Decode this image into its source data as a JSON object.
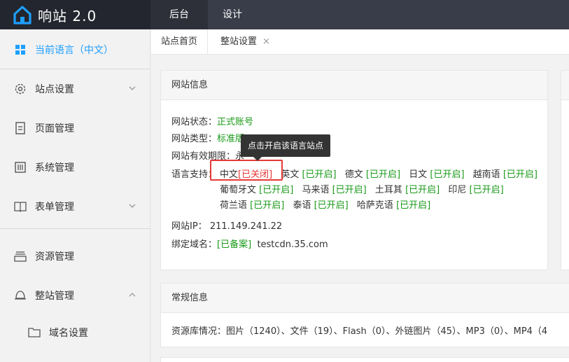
{
  "app": {
    "name": "响站 2.0"
  },
  "top_tabs": [
    {
      "label": "后台"
    },
    {
      "label": "设计"
    }
  ],
  "sidebar": {
    "items": [
      {
        "label": "当前语言（中文）",
        "icon": "grid-icon"
      },
      {
        "label": "站点设置",
        "icon": "gear-icon"
      },
      {
        "label": "页面管理",
        "icon": "document-icon"
      },
      {
        "label": "系统管理",
        "icon": "sliders-icon"
      },
      {
        "label": "表单管理",
        "icon": "book-icon"
      },
      {
        "label": "资源管理",
        "icon": "stack-icon"
      },
      {
        "label": "整站管理",
        "icon": "bell-icon"
      },
      {
        "label": "域名设置",
        "icon": "folder-icon"
      }
    ]
  },
  "page_tabs": [
    {
      "label": "站点首页"
    },
    {
      "label": "整站设置",
      "close": "×"
    }
  ],
  "site_info": {
    "title": "网站信息",
    "status_label": "网站状态：",
    "status_value": "正式账号",
    "type_label": "网站类型：",
    "type_value": "标准版",
    "expire_label": "网站有效期限：",
    "expire_value": "永",
    "lang_label": "语言支持：",
    "languages": [
      {
        "name": "中文",
        "state": "[已关闭]"
      },
      {
        "name": "英文",
        "state": "[已开启]"
      },
      {
        "name": "德文",
        "state": "[已开启]"
      },
      {
        "name": "日文",
        "state": "[已开启]"
      },
      {
        "name": "越南语",
        "state": "[已开启]"
      },
      {
        "name": "葡萄牙文",
        "state": "[已开启]"
      },
      {
        "name": "马来语",
        "state": "[已开启]"
      },
      {
        "name": "土耳其",
        "state": "[已开启]"
      },
      {
        "name": "印尼",
        "state": "[已开启]"
      },
      {
        "name": "荷兰语",
        "state": "[已开启]"
      },
      {
        "name": "泰语",
        "state": "[已开启]"
      },
      {
        "name": "哈萨克语",
        "state": "[已开启]"
      }
    ],
    "ip_label": "网站IP：",
    "ip_value": "211.149.241.22",
    "domain_label": "绑定域名：",
    "domain_state": "[已备案]",
    "domain_value": "testcdn.35.com"
  },
  "tooltip": {
    "text": "点击开启该语言站点"
  },
  "general_info": {
    "title": "常规信息",
    "resources": "资源库情况：图片（1240）、文件（19）、Flash（0）、外链图片（45）、MP3（0）、MP4（4"
  },
  "colors": {
    "accent": "#1e9fff",
    "green": "#1a9a1a",
    "red": "#e53935",
    "topbar": "#393d49"
  }
}
